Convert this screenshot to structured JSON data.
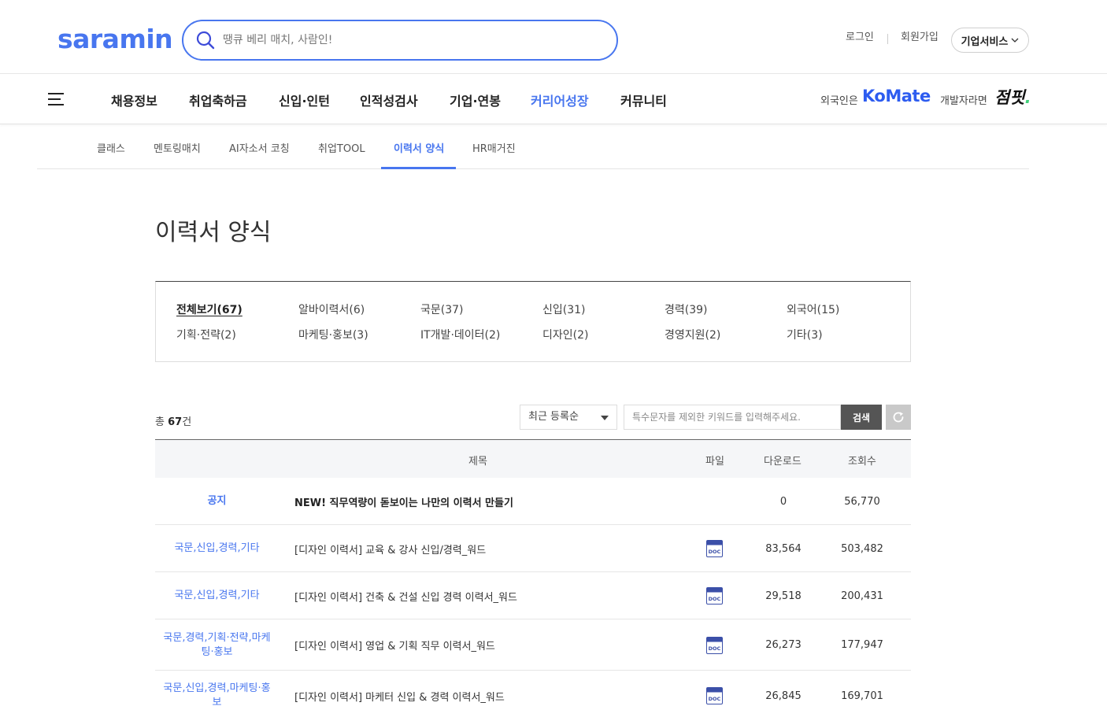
{
  "header": {
    "logo": "saramin",
    "search_placeholder": "땡큐 베리 매치, 사람인!",
    "login": "로그인",
    "signup": "회원가입",
    "business": "기업서비스"
  },
  "gnb": {
    "items": [
      "채용정보",
      "취업축하금",
      "신입·인턴",
      "인적성검사",
      "기업·연봉",
      "커리어성장",
      "커뮤니티"
    ],
    "active": "커리어성장",
    "komate_prefix": "외국인은",
    "komate_logo": "KoMate",
    "jumpit_prefix": "개발자라면",
    "jumpit_logo": "점핏"
  },
  "subnav": {
    "tabs": [
      "클래스",
      "멘토링매치",
      "AI자소서 코칭",
      "취업TOOL",
      "이력서 양식",
      "HR매거진"
    ],
    "active": "이력서 양식"
  },
  "page": {
    "title": "이력서 양식"
  },
  "categories": [
    [
      "전체보기(67)",
      "알바이력서(6)",
      "국문(37)",
      "신입(31)",
      "경력(39)",
      "외국어(15)"
    ],
    [
      "기획·전략(2)",
      "마케팅·홍보(3)",
      "IT개발·데이터(2)",
      "디자인(2)",
      "경영지원(2)",
      "기타(3)"
    ]
  ],
  "toolbar": {
    "total_prefix": "총",
    "total_count": "67",
    "total_suffix": "건",
    "sort": "최근 등록순",
    "keyword_placeholder": "특수문자를 제외한 키워드를 입력해주세요.",
    "search_button": "검색"
  },
  "table": {
    "headers": [
      "제목",
      "파일",
      "다운로드",
      "조회수"
    ],
    "notice": {
      "category": "공지",
      "title": "NEW! 직무역량이 돋보이는 나만의 이력서 만들기",
      "downloads": "0",
      "views": "56,770"
    },
    "rows": [
      {
        "category": "국문,신입,경력,기타",
        "title": "[디자인 이력서] 교육 & 강사 신입/경력_워드",
        "file": "DOC",
        "downloads": "83,564",
        "views": "503,482"
      },
      {
        "category": "국문,신입,경력,기타",
        "title": "[디자인 이력서] 건축 & 건설 신입 경력 이력서_워드",
        "file": "DOC",
        "downloads": "29,518",
        "views": "200,431"
      },
      {
        "category": "국문,경력,기획·전략,마케팅·홍보",
        "title": "[디자인 이력서] 영업 & 기획 직무 이력서_워드",
        "file": "DOC",
        "downloads": "26,273",
        "views": "177,947"
      },
      {
        "category": "국문,신입,경력,마케팅·홍보",
        "title": "[디자인 이력서] 마케터 신입 & 경력 이력서_워드",
        "file": "DOC",
        "downloads": "26,845",
        "views": "169,701"
      }
    ]
  },
  "colors": {
    "brand": "#4876ef",
    "komate": "#2d5cf0",
    "jumpit_dot": "#42d17a"
  }
}
